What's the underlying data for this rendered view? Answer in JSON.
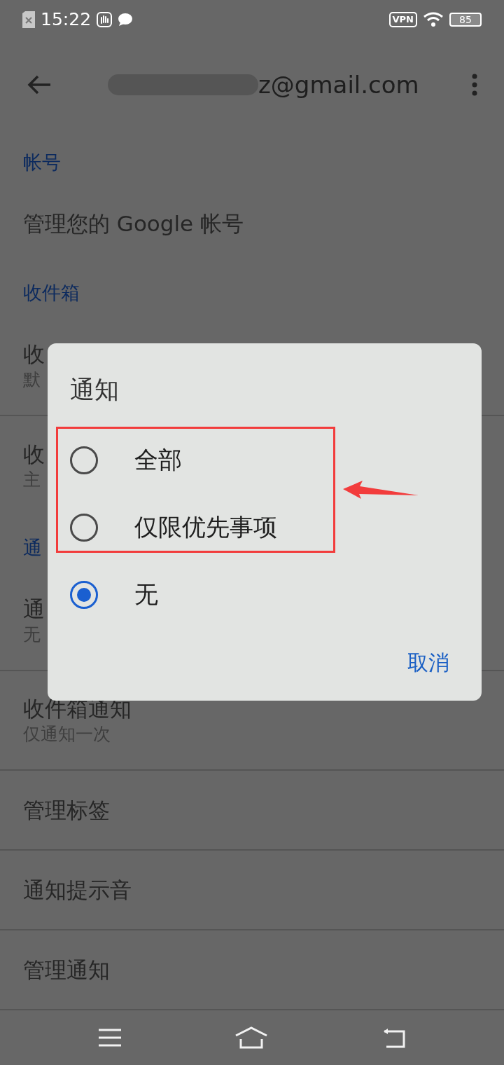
{
  "status_bar": {
    "time": "15:22",
    "vpn": "VPN",
    "battery": "85"
  },
  "toolbar": {
    "account": "z@gmail.com"
  },
  "sections": [
    {
      "kind": "header",
      "text": "帐号"
    },
    {
      "kind": "item",
      "title": "管理您的 Google 帐号"
    },
    {
      "kind": "header",
      "text": "收件箱"
    },
    {
      "kind": "item",
      "title": "收",
      "subtitle": "默",
      "divider": true
    },
    {
      "kind": "item",
      "title": "收",
      "subtitle": "主"
    },
    {
      "kind": "header",
      "text": "通"
    },
    {
      "kind": "item",
      "title": "通",
      "subtitle": "无",
      "divider": true
    },
    {
      "kind": "item",
      "title": "收件箱通知",
      "subtitle": "仅通知一次",
      "divider": true
    },
    {
      "kind": "item",
      "title": "管理标签",
      "divider": true
    },
    {
      "kind": "item",
      "title": "通知提示音",
      "divider": true
    },
    {
      "kind": "item",
      "title": "管理通知"
    }
  ],
  "dialog": {
    "title": "通知",
    "options": [
      {
        "label": "全部",
        "selected": false
      },
      {
        "label": "仅限优先事项",
        "selected": false
      },
      {
        "label": "无",
        "selected": true
      }
    ],
    "cancel": "取消"
  }
}
